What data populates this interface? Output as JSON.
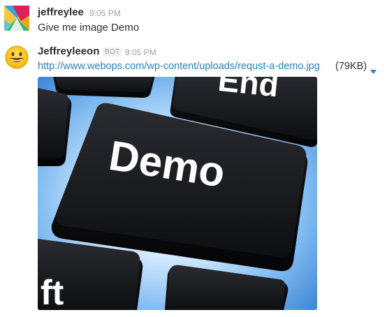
{
  "messages": [
    {
      "author": "jeffreylee",
      "time": "9:05 PM",
      "avatar": "colorful-logo-avatar",
      "text": "Give me image Demo"
    },
    {
      "author": "Jeffreyleeon",
      "badge": "BOT",
      "time": "9:05 PM",
      "avatar": "smiley-emoji-avatar",
      "link": "http://www.webops.com/wp-content/uploads/requst-a-demo.jpg",
      "file_size": "(79KB)",
      "preview": {
        "icon": "demo-key-image",
        "key_label": "Demo",
        "top_key_label": "End",
        "side_key_label": "ft"
      }
    }
  ],
  "colors": {
    "link": "#2a80b9",
    "text": "#2c2d30",
    "muted": "#9e9ea6"
  }
}
